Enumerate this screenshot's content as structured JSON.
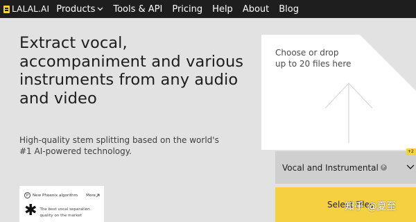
{
  "brand": {
    "name": "LALAL.AI",
    "accent": "#f5d142"
  },
  "nav": {
    "items": [
      {
        "label": "Products",
        "has_dropdown": true
      },
      {
        "label": "Tools & API"
      },
      {
        "label": "Pricing"
      },
      {
        "label": "Help"
      },
      {
        "label": "About"
      },
      {
        "label": "Blog"
      }
    ]
  },
  "hero": {
    "title": "Extract vocal, accompaniment and various instruments from any audio and video",
    "subtitle": "High-quality stem splitting based on the world's #1 AI-powered technology."
  },
  "algo_card": {
    "badge": "P",
    "label": "New Phoenix algorithm",
    "more": "More",
    "text_line1": "The best vocal separation",
    "text_line2": "quality on the market"
  },
  "upload": {
    "drop_text": "Choose or drop up to 20 files here",
    "select_value": "Vocal and Instrumental",
    "select_badge": "P",
    "plus_tag": "+2",
    "button_label": "Select Files"
  },
  "watermark": "知乎 @夏至"
}
